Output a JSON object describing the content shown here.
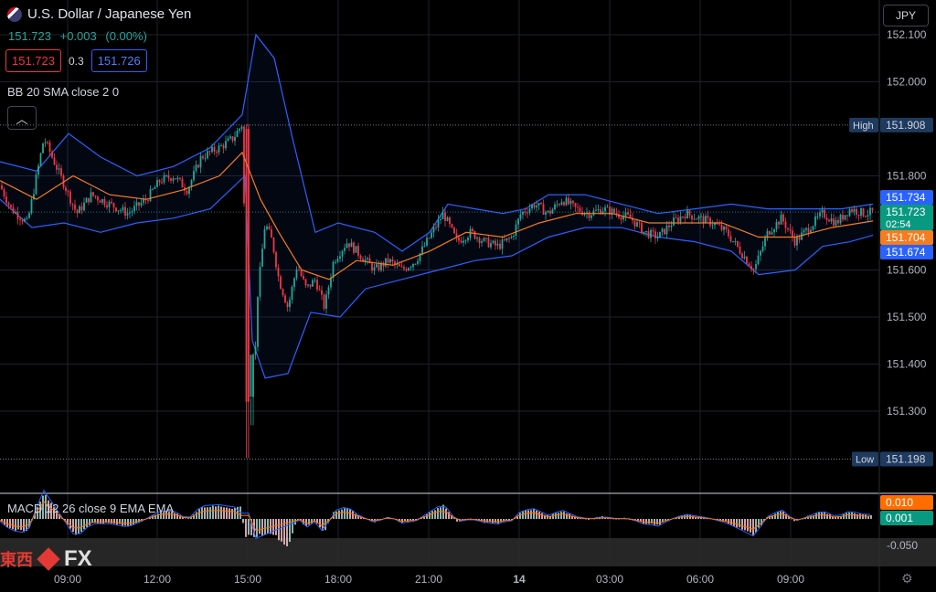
{
  "header": {
    "title": "U.S. Dollar / Japanese Yen",
    "last": "151.723",
    "change": "+0.003",
    "change_pct": "(0.00%)",
    "bid": "151.723",
    "spread": "0.3",
    "ask": "151.726",
    "indicator": "BB 20 SMA close 2 0",
    "currency": "JPY"
  },
  "macd": {
    "label": "MACD 12 26 close 9 EMA EMA"
  },
  "watermark": {
    "cn": "東西",
    "fx": "FX"
  },
  "colors": {
    "up": "#26a69a",
    "down": "#f23645",
    "bb_band": "#2962ff",
    "bb_basis": "#f57c20",
    "macd": "#2962ff",
    "signal": "#ff6d00"
  },
  "chart_data": {
    "type": "candlestick",
    "y_axis": {
      "ticks": [
        152.1,
        152.0,
        151.8,
        151.6,
        151.5,
        151.4,
        151.3
      ],
      "tick_labels": [
        "152.100",
        "152.000",
        "151.800",
        "151.600",
        "151.500",
        "151.400",
        "151.300"
      ]
    },
    "x_axis": {
      "labels": [
        "09:00",
        "12:00",
        "15:00",
        "18:00",
        "21:00",
        "14",
        "03:00",
        "06:00",
        "09:00"
      ]
    },
    "price_labels": {
      "high": {
        "label": "High",
        "value": "151.908"
      },
      "low": {
        "label": "Low",
        "value": "151.198"
      },
      "bb_upper": "151.734",
      "last": "151.723",
      "countdown": "02:54",
      "bb_basis": "151.704",
      "bb_lower": "151.674"
    },
    "price_path": [
      [
        0,
        151.78
      ],
      [
        12,
        151.73
      ],
      [
        30,
        151.7
      ],
      [
        48,
        151.88
      ],
      [
        66,
        151.8
      ],
      [
        84,
        151.72
      ],
      [
        100,
        151.76
      ],
      [
        120,
        151.74
      ],
      [
        140,
        151.72
      ],
      [
        160,
        151.75
      ],
      [
        175,
        151.79
      ],
      [
        190,
        151.8
      ],
      [
        205,
        151.77
      ],
      [
        220,
        151.84
      ],
      [
        240,
        151.86
      ],
      [
        255,
        151.88
      ],
      [
        265,
        151.91
      ],
      [
        271,
        151.4
      ],
      [
        276,
        151.27
      ],
      [
        282,
        151.55
      ],
      [
        290,
        151.7
      ],
      [
        298,
        151.66
      ],
      [
        305,
        151.58
      ],
      [
        315,
        151.52
      ],
      [
        325,
        151.61
      ],
      [
        335,
        151.56
      ],
      [
        345,
        151.58
      ],
      [
        355,
        151.52
      ],
      [
        365,
        151.62
      ],
      [
        380,
        151.66
      ],
      [
        395,
        151.63
      ],
      [
        410,
        151.6
      ],
      [
        425,
        151.62
      ],
      [
        440,
        151.6
      ],
      [
        455,
        151.62
      ],
      [
        470,
        151.67
      ],
      [
        485,
        151.72
      ],
      [
        500,
        151.66
      ],
      [
        515,
        151.68
      ],
      [
        530,
        151.66
      ],
      [
        545,
        151.65
      ],
      [
        560,
        151.67
      ],
      [
        570,
        151.72
      ],
      [
        585,
        151.74
      ],
      [
        600,
        151.72
      ],
      [
        615,
        151.75
      ],
      [
        630,
        151.73
      ],
      [
        645,
        151.72
      ],
      [
        660,
        151.73
      ],
      [
        675,
        151.72
      ],
      [
        690,
        151.71
      ],
      [
        705,
        151.68
      ],
      [
        720,
        151.67
      ],
      [
        735,
        151.7
      ],
      [
        750,
        151.72
      ],
      [
        765,
        151.71
      ],
      [
        780,
        151.7
      ],
      [
        795,
        151.68
      ],
      [
        810,
        151.64
      ],
      [
        825,
        151.6
      ],
      [
        840,
        151.68
      ],
      [
        855,
        151.71
      ],
      [
        870,
        151.66
      ],
      [
        885,
        151.69
      ],
      [
        900,
        151.72
      ],
      [
        915,
        151.7
      ],
      [
        930,
        151.73
      ],
      [
        945,
        151.72
      ],
      [
        955,
        151.723
      ]
    ],
    "bb_upper": [
      [
        0,
        151.83
      ],
      [
        40,
        151.81
      ],
      [
        75,
        151.89
      ],
      [
        110,
        151.84
      ],
      [
        150,
        151.8
      ],
      [
        190,
        151.82
      ],
      [
        230,
        151.86
      ],
      [
        265,
        151.93
      ],
      [
        280,
        152.1
      ],
      [
        300,
        152.05
      ],
      [
        320,
        151.88
      ],
      [
        345,
        151.68
      ],
      [
        370,
        151.7
      ],
      [
        410,
        151.68
      ],
      [
        440,
        151.64
      ],
      [
        470,
        151.68
      ],
      [
        490,
        151.74
      ],
      [
        520,
        151.73
      ],
      [
        550,
        151.72
      ],
      [
        575,
        151.73
      ],
      [
        600,
        151.76
      ],
      [
        640,
        151.76
      ],
      [
        680,
        151.74
      ],
      [
        720,
        151.72
      ],
      [
        760,
        151.73
      ],
      [
        800,
        151.74
      ],
      [
        840,
        151.73
      ],
      [
        880,
        151.73
      ],
      [
        920,
        151.73
      ],
      [
        955,
        151.74
      ]
    ],
    "bb_lower": [
      [
        0,
        151.75
      ],
      [
        35,
        151.69
      ],
      [
        70,
        151.7
      ],
      [
        110,
        151.68
      ],
      [
        150,
        151.7
      ],
      [
        190,
        151.71
      ],
      [
        230,
        151.73
      ],
      [
        268,
        151.8
      ],
      [
        276,
        151.45
      ],
      [
        290,
        151.37
      ],
      [
        315,
        151.38
      ],
      [
        340,
        151.51
      ],
      [
        372,
        151.5
      ],
      [
        400,
        151.56
      ],
      [
        440,
        151.58
      ],
      [
        480,
        151.6
      ],
      [
        520,
        151.62
      ],
      [
        560,
        151.63
      ],
      [
        600,
        151.67
      ],
      [
        640,
        151.69
      ],
      [
        680,
        151.69
      ],
      [
        720,
        151.67
      ],
      [
        760,
        151.66
      ],
      [
        800,
        151.64
      ],
      [
        830,
        151.59
      ],
      [
        870,
        151.6
      ],
      [
        900,
        151.65
      ],
      [
        930,
        151.66
      ],
      [
        955,
        151.674
      ]
    ],
    "bb_basis": [
      [
        0,
        151.79
      ],
      [
        40,
        151.75
      ],
      [
        80,
        151.8
      ],
      [
        120,
        151.76
      ],
      [
        160,
        151.75
      ],
      [
        200,
        151.77
      ],
      [
        240,
        151.8
      ],
      [
        265,
        151.85
      ],
      [
        285,
        151.75
      ],
      [
        305,
        151.68
      ],
      [
        330,
        151.6
      ],
      [
        360,
        151.58
      ],
      [
        390,
        151.62
      ],
      [
        430,
        151.61
      ],
      [
        470,
        151.64
      ],
      [
        510,
        151.68
      ],
      [
        550,
        151.67
      ],
      [
        590,
        151.7
      ],
      [
        630,
        151.72
      ],
      [
        670,
        151.72
      ],
      [
        710,
        151.7
      ],
      [
        750,
        151.7
      ],
      [
        790,
        151.7
      ],
      [
        830,
        151.67
      ],
      [
        870,
        151.67
      ],
      [
        910,
        151.69
      ],
      [
        955,
        151.704
      ]
    ],
    "macd_values": {
      "macd": "0.010",
      "signal": "0.001",
      "axis_tick": "-0.050"
    }
  }
}
